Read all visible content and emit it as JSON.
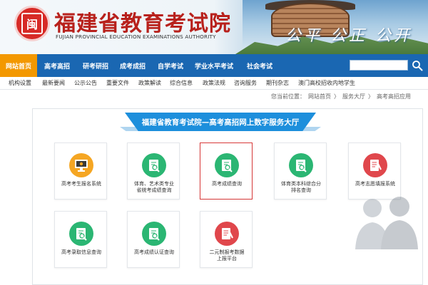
{
  "header": {
    "title": "福建省教育考试院",
    "subtitle": "FUJIAN PROVINCIAL EDUCATION EXAMINATIONS AUTHORITY",
    "motto": "公平 公正 公开",
    "logo_char": "闽"
  },
  "nav": {
    "home": "网站首页",
    "items": [
      "高考高招",
      "研考研招",
      "成考成招",
      "自学考试",
      "学业水平考试",
      "社会考试"
    ],
    "search_value": ""
  },
  "subnav": {
    "items": [
      "机构设置",
      "最新要闻",
      "公示公告",
      "重要文件",
      "政策解读",
      "综合信息",
      "政策法规",
      "咨询服务",
      "期刊杂志",
      "澳门高校招收内地学生"
    ]
  },
  "breadcrumb": {
    "label": "您当前位置：",
    "items": [
      "网站首页",
      "〉",
      "服务大厅",
      "〉",
      "高考高招应用"
    ]
  },
  "panel": {
    "title": "福建省教育考试院—高考高招网上数字服务大厅"
  },
  "cards": [
    {
      "label": "高考考生报名系统",
      "icon": "computer-icon",
      "color": "#f5a623"
    },
    {
      "label": "体育、艺术类专业\n省统考成绩查询",
      "icon": "clipboard-search-icon",
      "color": "#2bb673"
    },
    {
      "label": "高考成绩查询",
      "icon": "clipboard-search-icon",
      "color": "#2bb673"
    },
    {
      "label": "体育类本科综合分\n排名查询",
      "icon": "clipboard-search-icon",
      "color": "#2bb673"
    },
    {
      "label": "高考志愿填报系统",
      "icon": "document-pen-icon",
      "color": "#e0474c"
    },
    {
      "label": "高考录取信息查询",
      "icon": "clipboard-search-icon",
      "color": "#2bb673"
    },
    {
      "label": "高考成绩认证查询",
      "icon": "clipboard-search-icon",
      "color": "#2bb673"
    },
    {
      "label": "二元制报考数据\n上报平台",
      "icon": "document-pen-icon",
      "color": "#e0474c"
    }
  ],
  "colors": {
    "nav_blue": "#1a67b2",
    "home_orange": "#f39800",
    "title_red": "#b8211c",
    "panel_blue": "#1d8fdc"
  }
}
